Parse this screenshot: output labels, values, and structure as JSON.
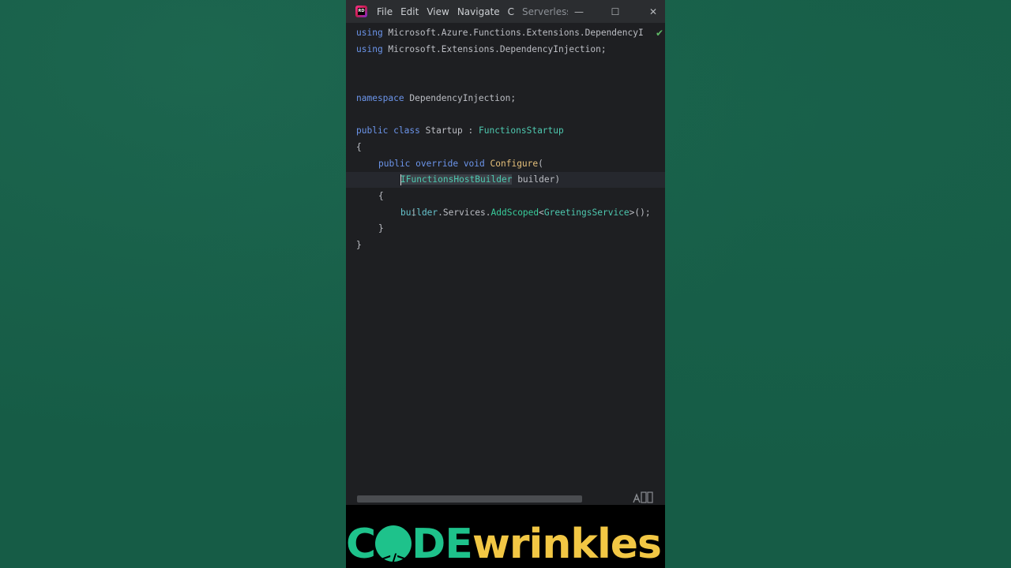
{
  "titlebar": {
    "logo_text": "RD",
    "menu": [
      {
        "label": "File"
      },
      {
        "label": "Edit"
      },
      {
        "label": "View"
      },
      {
        "label": "Navigate"
      },
      {
        "label": "C"
      }
    ],
    "project_title": "ServerlessR",
    "minimize_symbol": "—",
    "maximize_symbol": "☐",
    "close_symbol": "✕"
  },
  "editor": {
    "lines": {
      "l1_kw": "using",
      "l1_rest": " Microsoft.Azure.Functions.Extensions.DependencyI",
      "l2_kw": "using",
      "l2_rest": " Microsoft.Extensions.DependencyInjection;",
      "l5_kw": "namespace",
      "l5_rest": " DependencyInjection;",
      "l7_kw1": "public",
      "l7_kw2": "class",
      "l7_name": "Startup",
      "l7_colon": " : ",
      "l7_base": "FunctionsStartup",
      "l8": "{",
      "l9_kw1": "public",
      "l9_kw2": "override",
      "l9_kw3": "void",
      "l9_fn": "Configure",
      "l9_paren": "(",
      "l10_type": "IFunctionsHostBuilder",
      "l10_rest": " builder)",
      "l11": "{",
      "l12_a": "builder",
      "l12_b": ".Services.",
      "l12_fn": "AddScoped",
      "l12_lt": "<",
      "l12_type": "GreetingsService",
      "l12_end": ">();",
      "l13": "}",
      "l14": "}"
    },
    "inspection_status": "✔",
    "reader_mode_icon": "reader-mode-icon"
  },
  "brand": {
    "part1": "C",
    "o_glyph": "</>",
    "part2": "DE",
    "part3": "wrinkles"
  },
  "colors": {
    "background": "#165c46",
    "editor_bg": "#1e1f22",
    "keyword": "#6c95eb",
    "brand_green": "#1ec28b",
    "brand_yellow": "#f2c744"
  }
}
